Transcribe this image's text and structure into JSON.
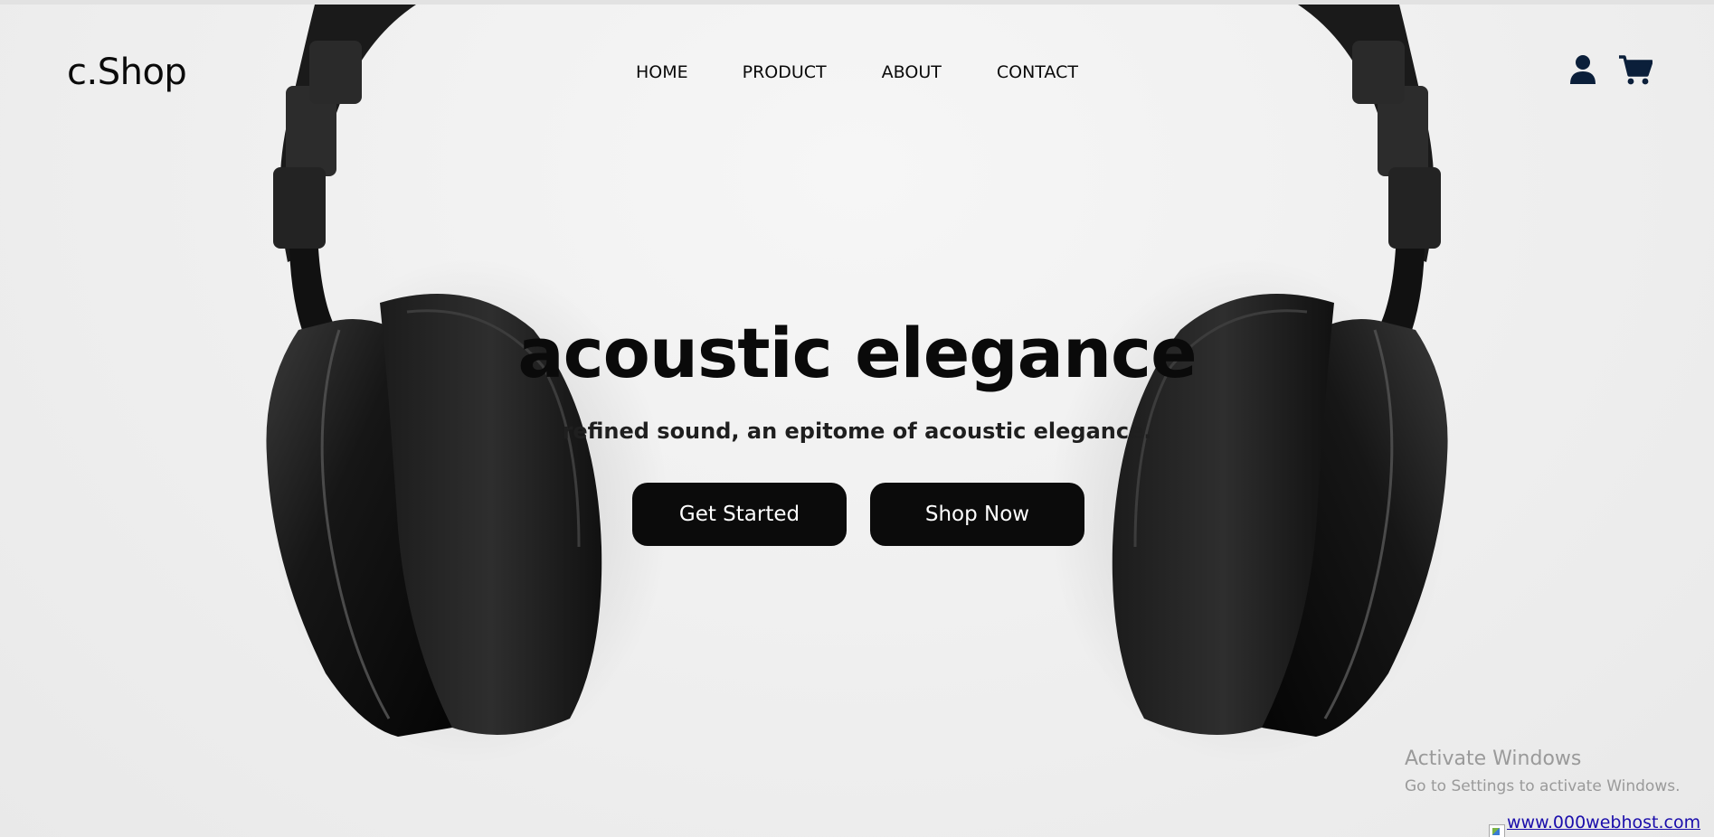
{
  "header": {
    "brand": "c.Shop",
    "nav": [
      {
        "label": "HOME"
      },
      {
        "label": "PRODUCT"
      },
      {
        "label": "ABOUT"
      },
      {
        "label": "CONTACT"
      }
    ],
    "icons": [
      "user-icon",
      "cart-icon"
    ]
  },
  "hero": {
    "title": "acoustic elegance",
    "subtitle": "refined sound, an epitome of acoustic elegance.",
    "primary_button": "Get Started",
    "secondary_button": "Shop Now",
    "image": "headphones-image"
  },
  "overlay": {
    "activate_title": "Activate Windows",
    "activate_subtitle": "Go to Settings to activate Windows.",
    "host_link": "www.000webhost.com"
  },
  "colors": {
    "background": "#f0f0f0",
    "text": "#0a0a0a",
    "button_bg": "#0b0b0b",
    "button_text": "#ffffff",
    "icon": "#0b1f3a",
    "watermark": "#9a9a9a",
    "link": "#1a0dab"
  }
}
